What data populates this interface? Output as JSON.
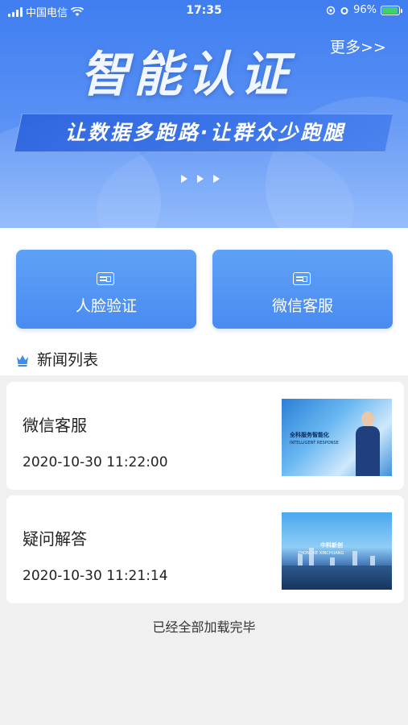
{
  "status_bar": {
    "carrier": "中国电信",
    "time": "17:35",
    "battery": "96%",
    "battery_level": 0.96
  },
  "banner": {
    "title": "智能认证",
    "more_link": "更多>>",
    "slogan": "让数据多跑路·让群众少跑腿"
  },
  "quick_actions": [
    {
      "label": "人脸验证",
      "icon": "id-card-icon"
    },
    {
      "label": "微信客服",
      "icon": "id-card-icon"
    }
  ],
  "news_section": {
    "title": "新闻列表",
    "icon": "crown-icon"
  },
  "news": [
    {
      "title": "微信客服",
      "time": "2020-10-30 11:22:00",
      "thumb_text": "全科服务智能化",
      "thumb_sub": "INTELLIGENT RESPONSE"
    },
    {
      "title": "疑问解答",
      "time": "2020-10-30 11:21:14",
      "thumb_text": "中科新创",
      "thumb_sub": "ZHONGKE XINCHUANG"
    }
  ],
  "footer": "已经全部加载完毕",
  "colors": {
    "primary": "#4a8bf1",
    "background": "#f0f0f0"
  }
}
